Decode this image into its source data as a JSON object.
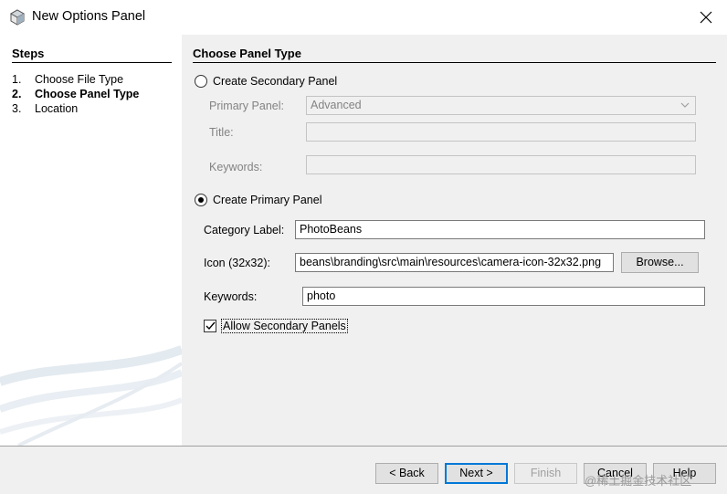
{
  "window": {
    "title": "New Options Panel",
    "app_icon": "cube-icon",
    "close_icon": "close-icon"
  },
  "steps": {
    "heading": "Steps",
    "items": [
      {
        "num": "1.",
        "label": "Choose File Type",
        "active": false
      },
      {
        "num": "2.",
        "label": "Choose Panel Type",
        "active": true
      },
      {
        "num": "3.",
        "label": "Location",
        "active": false
      }
    ]
  },
  "panel": {
    "heading": "Choose Panel Type",
    "secondary": {
      "radio_label": "Create Secondary Panel",
      "selected": false,
      "primary_panel_label": "Primary Panel:",
      "primary_panel_value": "Advanced",
      "title_label": "Title:",
      "title_value": "",
      "keywords_label": "Keywords:",
      "keywords_value": ""
    },
    "primary": {
      "radio_label": "Create Primary Panel",
      "selected": true,
      "category_label": "Category Label:",
      "category_value": "PhotoBeans",
      "icon_label": "Icon (32x32):",
      "icon_value": "beans\\branding\\src\\main\\resources\\camera-icon-32x32.png",
      "browse_label": "Browse...",
      "keywords_label": "Keywords:",
      "keywords_value": "photo",
      "allow_secondary_label": "Allow Secondary Panels",
      "allow_secondary_checked": true
    }
  },
  "footer": {
    "back_label": "< Back",
    "next_label": "Next >",
    "finish_label": "Finish",
    "cancel_label": "Cancel",
    "help_label": "Help",
    "watermark": "@稀土掘金技术社区"
  },
  "colors": {
    "accent": "#0078d7",
    "dialog_bg": "#f0f0f0",
    "steps_bg": "#ffffff",
    "disabled_text": "#838383"
  }
}
